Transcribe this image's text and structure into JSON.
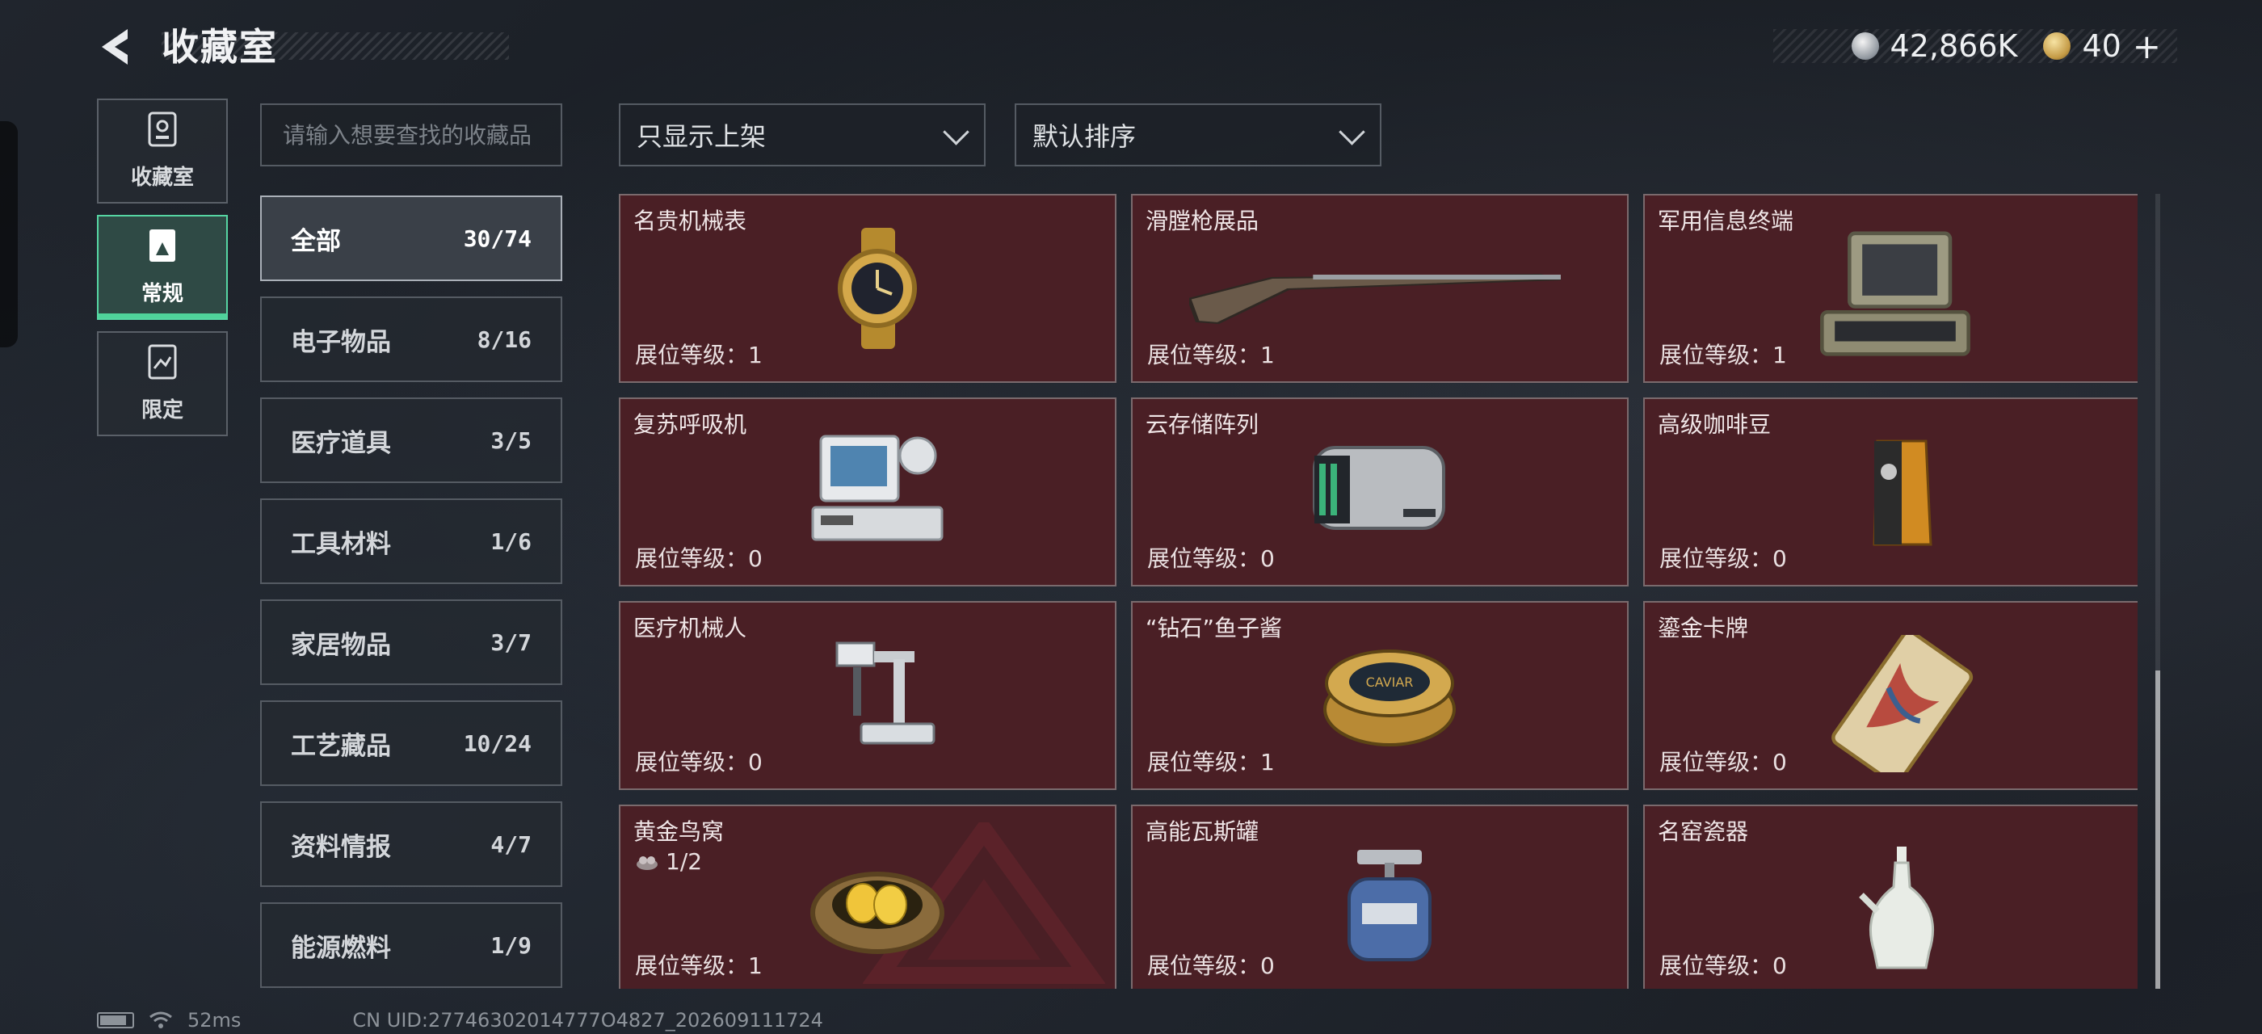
{
  "header": {
    "title": "收藏室",
    "currency_silver": "42,866K",
    "currency_gold": "40",
    "currency_add": "+"
  },
  "modes": [
    {
      "label": "收藏室",
      "icon": "trophy-icon"
    },
    {
      "label": "常规",
      "icon": "collection-icon",
      "active": true
    },
    {
      "label": "限定",
      "icon": "limited-icon"
    }
  ],
  "search": {
    "placeholder": "请输入想要查找的收藏品"
  },
  "filters": {
    "shelf_filter": "只显示上架",
    "sort_order": "默认排序"
  },
  "categories": [
    {
      "label": "全部",
      "count": "30/74",
      "active": true
    },
    {
      "label": "电子物品",
      "count": "8/16"
    },
    {
      "label": "医疗道具",
      "count": "3/5"
    },
    {
      "label": "工具材料",
      "count": "1/6"
    },
    {
      "label": "家居物品",
      "count": "3/7"
    },
    {
      "label": "工艺藏品",
      "count": "10/24"
    },
    {
      "label": "资料情报",
      "count": "4/7"
    },
    {
      "label": "能源燃料",
      "count": "1/9"
    }
  ],
  "items": [
    {
      "name": "名贵机械表",
      "level": "展位等级：1",
      "icon": "watch-icon"
    },
    {
      "name": "滑膛枪展品",
      "level": "展位等级：1",
      "icon": "musket-icon"
    },
    {
      "name": "军用信息终端",
      "level": "展位等级：1",
      "icon": "terminal-icon"
    },
    {
      "name": "复苏呼吸机",
      "level": "展位等级：0",
      "icon": "ventilator-icon"
    },
    {
      "name": "云存储阵列",
      "level": "展位等级：0",
      "icon": "storage-array-icon"
    },
    {
      "name": "高级咖啡豆",
      "level": "展位等级：0",
      "icon": "coffee-bag-icon"
    },
    {
      "name": "医疗机械人",
      "level": "展位等级：0",
      "icon": "medical-robot-icon"
    },
    {
      "name": "“钻石”鱼子酱",
      "level": "展位等级：1",
      "icon": "caviar-tin-icon"
    },
    {
      "name": "鎏金卡牌",
      "level": "展位等级：0",
      "icon": "gold-card-icon"
    },
    {
      "name": "黄金鸟窝",
      "level": "展位等级：1",
      "icon": "golden-nest-icon",
      "extra": "1/2"
    },
    {
      "name": "高能瓦斯罐",
      "level": "展位等级：0",
      "icon": "gas-canister-icon"
    },
    {
      "name": "名窑瓷器",
      "level": "展位等级：0",
      "icon": "porcelain-vase-icon"
    }
  ],
  "caviar_lid_text": "CAVIAR",
  "footer": {
    "ping": "52ms",
    "uid": "CN UID:27746302014777O4827_202609111724"
  }
}
